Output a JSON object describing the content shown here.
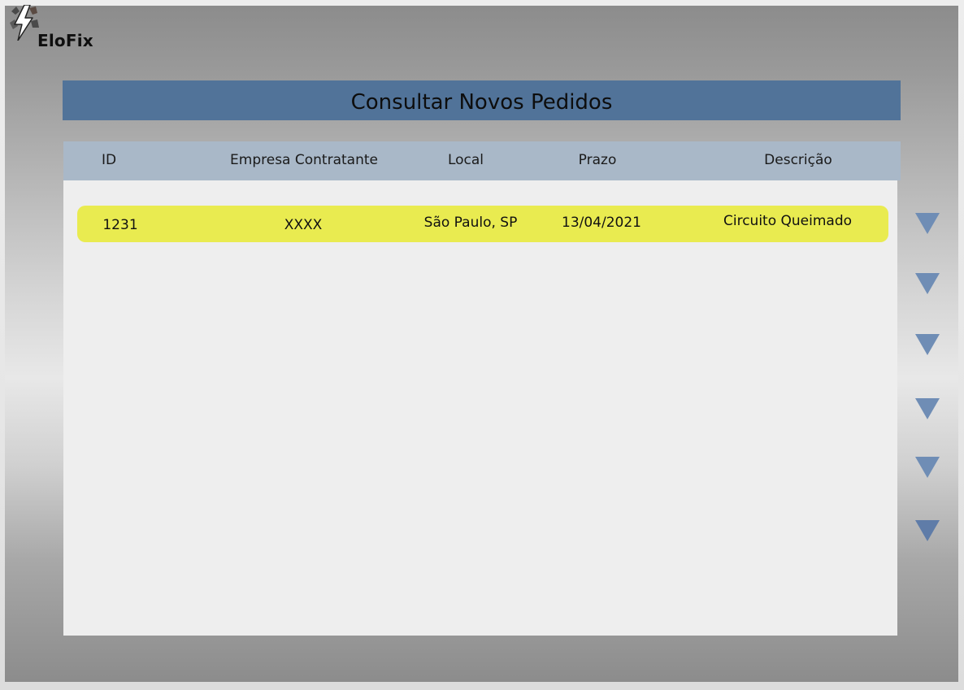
{
  "app": {
    "name": "EloFix"
  },
  "page": {
    "title": "Consultar Novos Pedidos"
  },
  "table": {
    "columns": [
      "ID",
      "Empresa Contratante",
      "Local",
      "Prazo",
      "Descrição"
    ],
    "rows": [
      {
        "id": "1231",
        "empresa": "XXXX",
        "local": "São Paulo, SP",
        "prazo": "13/04/2021",
        "descricao": "Circuito Queimado"
      }
    ]
  },
  "colors": {
    "title_bar": "#517399",
    "header_row": "#a9b8c8",
    "selected_row": "#e9eb50",
    "panel": "#eeeeee",
    "arrow": "#6f8db5"
  },
  "icons": {
    "logo": "lightning-bolt-logo-icon",
    "expand": "triangle-down-icon"
  }
}
